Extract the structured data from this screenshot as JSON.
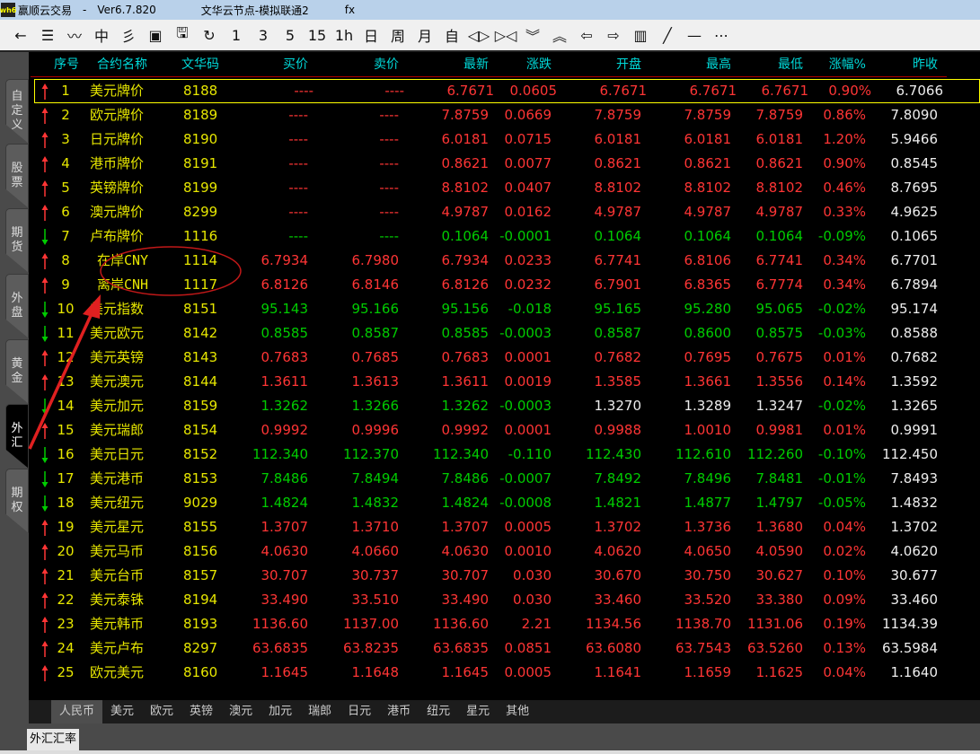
{
  "title": {
    "app": "赢顺云交易",
    "sep": "-",
    "version": "Ver6.7.820",
    "server": "文华云节点-模拟联通2",
    "extra": "fx",
    "logo_text": "wh6"
  },
  "toolbar": [
    {
      "icon": "back-icon",
      "glyph": "←"
    },
    {
      "icon": "list-icon",
      "glyph": "☰"
    },
    {
      "icon": "line-chart-icon",
      "glyph": "〰"
    },
    {
      "icon": "candlestick-icon",
      "glyph": "中"
    },
    {
      "icon": "flash-order-icon",
      "glyph": "彡"
    },
    {
      "icon": "order-book-icon",
      "glyph": "▣"
    },
    {
      "icon": "save-icon",
      "glyph": "🖫"
    },
    {
      "icon": "refresh-icon",
      "glyph": "↻"
    },
    {
      "icon": "period-1m",
      "glyph": "1"
    },
    {
      "icon": "period-3m",
      "glyph": "3"
    },
    {
      "icon": "period-5m",
      "glyph": "5"
    },
    {
      "icon": "period-15m",
      "glyph": "15"
    },
    {
      "icon": "period-1h",
      "glyph": "1h"
    },
    {
      "icon": "period-day",
      "glyph": "日"
    },
    {
      "icon": "period-week",
      "glyph": "周"
    },
    {
      "icon": "period-month",
      "glyph": "月"
    },
    {
      "icon": "period-custom",
      "glyph": "自"
    },
    {
      "icon": "zoom-out-icon",
      "glyph": "◁▷"
    },
    {
      "icon": "zoom-in-icon",
      "glyph": "▷◁"
    },
    {
      "icon": "chevron-down-icon",
      "glyph": "︾"
    },
    {
      "icon": "chevron-up-icon",
      "glyph": "︽"
    },
    {
      "icon": "arrow-left-icon",
      "glyph": "⇦"
    },
    {
      "icon": "arrow-right-icon",
      "glyph": "⇨"
    },
    {
      "icon": "layout-icon",
      "glyph": "▥"
    },
    {
      "icon": "draw-line-icon",
      "glyph": "╱"
    },
    {
      "icon": "horizontal-line-icon",
      "glyph": "—"
    },
    {
      "icon": "more-icon",
      "glyph": "⋯"
    }
  ],
  "sidebar": [
    {
      "label": "自定义",
      "active": false
    },
    {
      "label": "股票",
      "active": false
    },
    {
      "label": "期货",
      "active": false
    },
    {
      "label": "外盘",
      "active": false
    },
    {
      "label": "黄金",
      "active": false
    },
    {
      "label": "外汇",
      "active": true
    },
    {
      "label": "期权",
      "active": false
    }
  ],
  "columns": [
    "序号",
    "合约名称",
    "文华码",
    "买价",
    "卖价",
    "最新",
    "涨跌",
    "开盘",
    "最高",
    "最低",
    "涨幅%",
    "昨收"
  ],
  "rows": [
    {
      "dir": "up",
      "v": [
        "1",
        "美元牌价",
        "8188",
        "----",
        "----",
        "6.7671",
        "0.0605",
        "6.7671",
        "6.7671",
        "6.7671",
        "0.90%",
        "6.7066"
      ]
    },
    {
      "dir": "up",
      "v": [
        "2",
        "欧元牌价",
        "8189",
        "----",
        "----",
        "7.8759",
        "0.0669",
        "7.8759",
        "7.8759",
        "7.8759",
        "0.86%",
        "7.8090"
      ]
    },
    {
      "dir": "up",
      "v": [
        "3",
        "日元牌价",
        "8190",
        "----",
        "----",
        "6.0181",
        "0.0715",
        "6.0181",
        "6.0181",
        "6.0181",
        "1.20%",
        "5.9466"
      ]
    },
    {
      "dir": "up",
      "v": [
        "4",
        "港币牌价",
        "8191",
        "----",
        "----",
        "0.8621",
        "0.0077",
        "0.8621",
        "0.8621",
        "0.8621",
        "0.90%",
        "0.8545"
      ]
    },
    {
      "dir": "up",
      "v": [
        "5",
        "英镑牌价",
        "8199",
        "----",
        "----",
        "8.8102",
        "0.0407",
        "8.8102",
        "8.8102",
        "8.8102",
        "0.46%",
        "8.7695"
      ]
    },
    {
      "dir": "up",
      "v": [
        "6",
        "澳元牌价",
        "8299",
        "----",
        "----",
        "4.9787",
        "0.0162",
        "4.9787",
        "4.9787",
        "4.9787",
        "0.33%",
        "4.9625"
      ]
    },
    {
      "dir": "down",
      "v": [
        "7",
        "卢布牌价",
        "1116",
        "----",
        "----",
        "0.1064",
        "-0.0001",
        "0.1064",
        "0.1064",
        "0.1064",
        "-0.09%",
        "0.1065"
      ]
    },
    {
      "dir": "up",
      "v": [
        "8",
        "在岸CNY",
        "1114",
        "6.7934",
        "6.7980",
        "6.7934",
        "0.0233",
        "6.7741",
        "6.8106",
        "6.7741",
        "0.34%",
        "6.7701"
      ]
    },
    {
      "dir": "up",
      "v": [
        "9",
        "离岸CNH",
        "1117",
        "6.8126",
        "6.8146",
        "6.8126",
        "0.0232",
        "6.7901",
        "6.8365",
        "6.7774",
        "0.34%",
        "6.7894"
      ]
    },
    {
      "dir": "down",
      "v": [
        "10",
        "美元指数",
        "8151",
        "95.143",
        "95.166",
        "95.156",
        "-0.018",
        "95.165",
        "95.280",
        "95.065",
        "-0.02%",
        "95.174"
      ]
    },
    {
      "dir": "down",
      "v": [
        "11",
        "美元欧元",
        "8142",
        "0.8585",
        "0.8587",
        "0.8585",
        "-0.0003",
        "0.8587",
        "0.8600",
        "0.8575",
        "-0.03%",
        "0.8588"
      ]
    },
    {
      "dir": "up",
      "v": [
        "12",
        "美元英镑",
        "8143",
        "0.7683",
        "0.7685",
        "0.7683",
        "0.0001",
        "0.7682",
        "0.7695",
        "0.7675",
        "0.01%",
        "0.7682"
      ]
    },
    {
      "dir": "up",
      "v": [
        "13",
        "美元澳元",
        "8144",
        "1.3611",
        "1.3613",
        "1.3611",
        "0.0019",
        "1.3585",
        "1.3661",
        "1.3556",
        "0.14%",
        "1.3592"
      ]
    },
    {
      "dir": "down",
      "neutral": [
        7,
        8,
        9
      ],
      "v": [
        "14",
        "美元加元",
        "8159",
        "1.3262",
        "1.3266",
        "1.3262",
        "-0.0003",
        "1.3270",
        "1.3289",
        "1.3247",
        "-0.02%",
        "1.3265"
      ]
    },
    {
      "dir": "up",
      "v": [
        "15",
        "美元瑞郎",
        "8154",
        "0.9992",
        "0.9996",
        "0.9992",
        "0.0001",
        "0.9988",
        "1.0010",
        "0.9981",
        "0.01%",
        "0.9991"
      ]
    },
    {
      "dir": "down",
      "v": [
        "16",
        "美元日元",
        "8152",
        "112.340",
        "112.370",
        "112.340",
        "-0.110",
        "112.430",
        "112.610",
        "112.260",
        "-0.10%",
        "112.450"
      ]
    },
    {
      "dir": "down",
      "v": [
        "17",
        "美元港币",
        "8153",
        "7.8486",
        "7.8494",
        "7.8486",
        "-0.0007",
        "7.8492",
        "7.8496",
        "7.8481",
        "-0.01%",
        "7.8493"
      ]
    },
    {
      "dir": "down",
      "v": [
        "18",
        "美元纽元",
        "9029",
        "1.4824",
        "1.4832",
        "1.4824",
        "-0.0008",
        "1.4821",
        "1.4877",
        "1.4797",
        "-0.05%",
        "1.4832"
      ]
    },
    {
      "dir": "up",
      "v": [
        "19",
        "美元星元",
        "8155",
        "1.3707",
        "1.3710",
        "1.3707",
        "0.0005",
        "1.3702",
        "1.3736",
        "1.3680",
        "0.04%",
        "1.3702"
      ]
    },
    {
      "dir": "up",
      "v": [
        "20",
        "美元马币",
        "8156",
        "4.0630",
        "4.0660",
        "4.0630",
        "0.0010",
        "4.0620",
        "4.0650",
        "4.0590",
        "0.02%",
        "4.0620"
      ]
    },
    {
      "dir": "up",
      "v": [
        "21",
        "美元台币",
        "8157",
        "30.707",
        "30.737",
        "30.707",
        "0.030",
        "30.670",
        "30.750",
        "30.627",
        "0.10%",
        "30.677"
      ]
    },
    {
      "dir": "up",
      "v": [
        "22",
        "美元泰铢",
        "8194",
        "33.490",
        "33.510",
        "33.490",
        "0.030",
        "33.460",
        "33.520",
        "33.380",
        "0.09%",
        "33.460"
      ]
    },
    {
      "dir": "up",
      "v": [
        "23",
        "美元韩币",
        "8193",
        "1136.60",
        "1137.00",
        "1136.60",
        "2.21",
        "1134.56",
        "1138.70",
        "1131.06",
        "0.19%",
        "1134.39"
      ]
    },
    {
      "dir": "up",
      "v": [
        "24",
        "美元卢布",
        "8297",
        "63.6835",
        "63.8235",
        "63.6835",
        "0.0851",
        "63.6080",
        "63.7543",
        "63.5260",
        "0.13%",
        "63.5984"
      ]
    },
    {
      "dir": "up",
      "v": [
        "25",
        "欧元美元",
        "8160",
        "1.1645",
        "1.1648",
        "1.1645",
        "0.0005",
        "1.1641",
        "1.1659",
        "1.1625",
        "0.04%",
        "1.1640"
      ]
    }
  ],
  "bottom_tabs": [
    {
      "label": "人民币",
      "active": true
    },
    {
      "label": "美元"
    },
    {
      "label": "欧元"
    },
    {
      "label": "英镑"
    },
    {
      "label": "澳元"
    },
    {
      "label": "加元"
    },
    {
      "label": "瑞郎"
    },
    {
      "label": "日元"
    },
    {
      "label": "港币"
    },
    {
      "label": "纽元"
    },
    {
      "label": "星元"
    },
    {
      "label": "其他"
    }
  ],
  "status_tab": "外汇汇率",
  "colors": {
    "up": "#ff3535",
    "down": "#00cc00",
    "header": "#00d8d8",
    "name": "#e6e600",
    "annotation": "#e02020"
  }
}
